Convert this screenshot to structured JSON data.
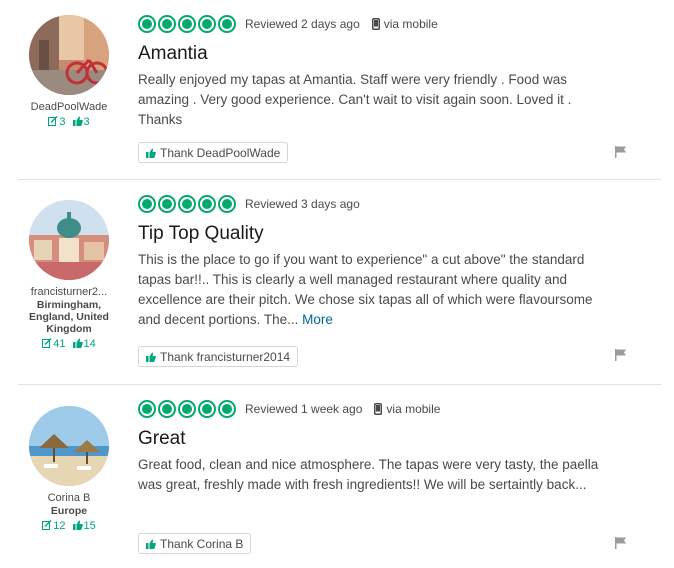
{
  "colors": {
    "bubble": "#00aa6c",
    "count": "#00a680",
    "link": "#006699"
  },
  "reviews": [
    {
      "user": {
        "name": "DeadPoolWade",
        "location": "",
        "reviews": "3",
        "helpful": "3"
      },
      "rating": 5,
      "date": "Reviewed 2 days ago",
      "mobile": "via mobile",
      "title": "Amantia",
      "body": "Really enjoyed my tapas at Amantia. Staff were very friendly . Food was amazing . Very good experience. Can't wait to visit again soon. Loved it . Thanks",
      "more": "",
      "thank": "Thank DeadPoolWade"
    },
    {
      "user": {
        "name": "francisturner2...",
        "location": "Birmingham, England, United Kingdom",
        "reviews": "41",
        "helpful": "14"
      },
      "rating": 5,
      "date": "Reviewed 3 days ago",
      "mobile": "",
      "title": "Tip Top Quality",
      "body": "This is the place to go if you want to experience\" a cut above\" the standard tapas bar!!.. This is clearly a well managed restaurant where quality and excellence are their pitch. We chose six tapas all of which were flavoursome and decent portions. The...",
      "more": "More",
      "thank": "Thank francisturner2014"
    },
    {
      "user": {
        "name": "Corina B",
        "location": "Europe",
        "reviews": "12",
        "helpful": "15"
      },
      "rating": 5,
      "date": "Reviewed 1 week ago",
      "mobile": "via mobile",
      "title": "Great",
      "body": "Great food, clean and nice atmosphere. The tapas were very tasty, the paella was great, freshly made with fresh ingredients!! We will be sertaintly back...",
      "more": "",
      "thank": "Thank Corina B"
    }
  ]
}
